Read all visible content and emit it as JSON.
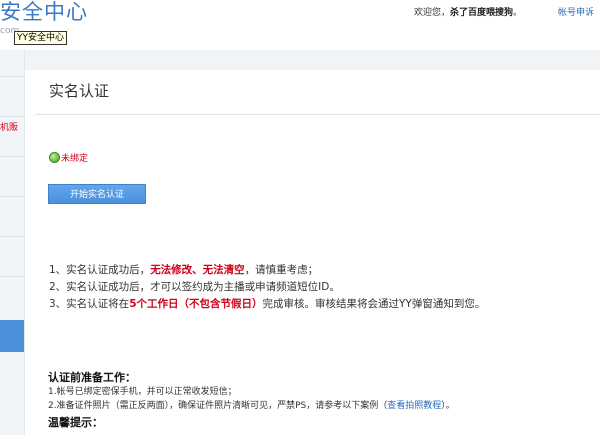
{
  "header": {
    "logo_text": "安全中心",
    "logo_sub": "com",
    "tooltip": "YY安全中心",
    "welcome_prefix": "欢迎您，",
    "username": "杀了百度喂搜狗",
    "welcome_suffix": "。",
    "apply_link": "帐号申诉"
  },
  "left_nav": {
    "visible_label": "机贩"
  },
  "page": {
    "title": "实名认证",
    "status": "未绑定",
    "start_button": "开始实名认证"
  },
  "notes": {
    "n1_prefix": "1、实名认证成功后，",
    "n1_red": "无法修改、无法清空",
    "n1_suffix": "，请慎重考虑；",
    "n2": "2、实名认证成功后，才可以签约成为主播或申请频道短位ID。",
    "n3_prefix": "3、实名认证将在",
    "n3_red": "5个工作日（不包含节假日）",
    "n3_suffix": "完成审核。审核结果将会通过YY弹窗通知到您。"
  },
  "preparation": {
    "title": "认证前准备工作：",
    "item1": "1.帐号已绑定密保手机，并可以正常收发短信；",
    "item2_prefix": "2.准备证件照片（需正反两面），确保证件照片清晰可见，严禁PS，请参考以下案例（",
    "item2_link": "查看拍照教程",
    "item2_suffix": "）。"
  },
  "tips": {
    "title": "温馨提示："
  }
}
